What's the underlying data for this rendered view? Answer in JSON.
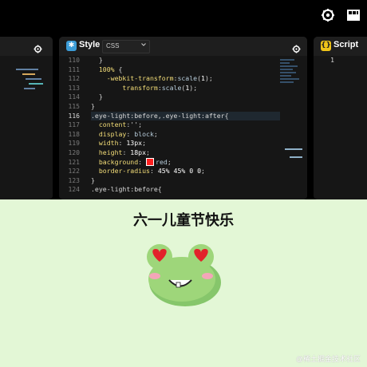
{
  "toolbar": {
    "gear_icon": "gear-icon",
    "layout_icon": "layout-icon"
  },
  "panels": {
    "css": {
      "title": "Style",
      "mode": "CSS"
    },
    "js": {
      "title": "Script",
      "line_no": "1"
    }
  },
  "css_code": {
    "line_numbers": [
      "110",
      "111",
      "112",
      "113",
      "114",
      "115",
      "116",
      "117",
      "118",
      "119",
      "120",
      "121",
      "122",
      "123",
      "124"
    ],
    "current_line": "116"
  },
  "scene": {
    "title": "六一儿童节快乐",
    "watermark": "@稀土掘金技术社区"
  }
}
